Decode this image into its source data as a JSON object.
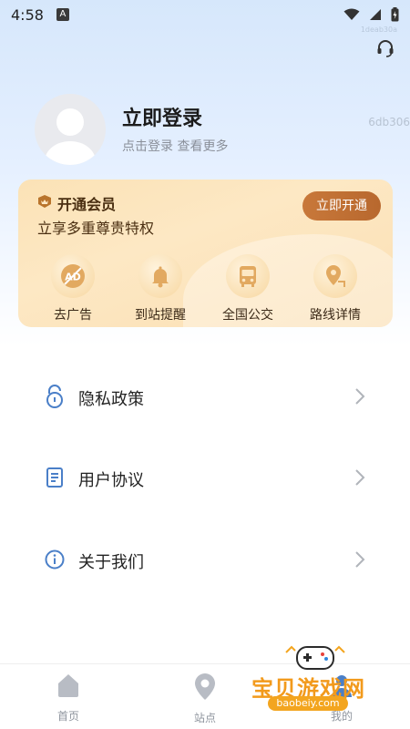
{
  "status": {
    "time": "4:58",
    "notif_glyph": "A",
    "tiny_id": "1deab30a"
  },
  "header": {
    "side_id": "6db306"
  },
  "profile": {
    "title": "立即登录",
    "subtitle": "点击登录 查看更多"
  },
  "vip": {
    "title": "开通会员",
    "subtitle": "立享多重尊贵特权",
    "button": "立即开通",
    "perks": [
      {
        "label": "去广告",
        "icon": "no-ads-icon"
      },
      {
        "label": "到站提醒",
        "icon": "bell-icon"
      },
      {
        "label": "全国公交",
        "icon": "bus-icon"
      },
      {
        "label": "路线详情",
        "icon": "route-pin-icon"
      }
    ]
  },
  "menu": [
    {
      "label": "隐私政策",
      "icon": "lock-icon"
    },
    {
      "label": "用户协议",
      "icon": "document-icon"
    },
    {
      "label": "关于我们",
      "icon": "info-icon"
    }
  ],
  "nav": [
    {
      "label": "首页",
      "icon": "home-icon"
    },
    {
      "label": "站点",
      "icon": "location-pin-icon"
    },
    {
      "label": "我的",
      "icon": "profile-icon"
    }
  ],
  "watermark": {
    "title": "宝贝游戏网",
    "url": "baobeiy.com"
  },
  "colors": {
    "accent_orange": "#c8783a",
    "vip_text": "#4a2f12",
    "icon_blue": "#4a7fc8",
    "nav_gray": "#b8bcc4"
  }
}
